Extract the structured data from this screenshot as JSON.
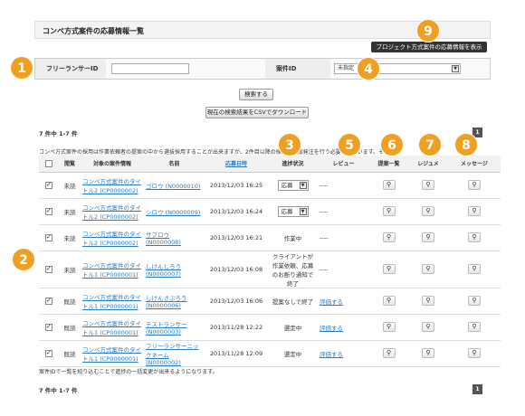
{
  "page": {
    "title": "コンペ方式案件の応募情報一覧",
    "view_project_button": "プロジェクト方式案件の応募情報を表示"
  },
  "search": {
    "freelancer_id_label": "フリーランサーID",
    "freelancer_id_value": "",
    "project_id_label": "案件ID",
    "project_select_value": "未指定",
    "search_button": "検索する",
    "csv_button": "現在の検索結果をCSVでダウンロード"
  },
  "summary": {
    "count_top": "7 件中 1-7 件",
    "count_bottom": "7 件中 1-7 件",
    "page": "1"
  },
  "notice": "コンペ方式案件の採用は作業依頼者の提案の中から選抜採用することが出来ますが、2件目以降の採用は追加発注を行う必要がございます。その場合、追加発注費用が発生いたします。",
  "footer_note": "案件IDで一覧を絞り込むことで進捗の一括変更が出来るようになります。",
  "table": {
    "headers": [
      "",
      "閲覧",
      "対象の案件情報",
      "名前",
      "応募日時",
      "進捗状況",
      "レビュー",
      "提案一覧",
      "レジュメ",
      "メッセージ"
    ],
    "rows": [
      {
        "read": "未読",
        "project": "コンペ方式案件のタイトル2 (CP0000002)",
        "name": "ゴロウ (N0000010)",
        "date": "2013/12/03 16:25",
        "status": "応募",
        "status_type": "select",
        "review": "----",
        "review_type": "text"
      },
      {
        "read": "未読",
        "project": "コンペ方式案件のタイトル2 (CP0000002)",
        "name": "シロウ (N0000009)",
        "date": "2013/12/03 16:24",
        "status": "応募",
        "status_type": "select",
        "review": "----",
        "review_type": "text"
      },
      {
        "read": "未読",
        "project": "コンペ方式案件のタイトル2 (CP0000002)",
        "name": "サブロウ (N0000008)",
        "date": "2013/12/03 16:21",
        "status": "作業中",
        "status_type": "text",
        "review": "----",
        "review_type": "text"
      },
      {
        "read": "未読",
        "project": "コンペ方式案件のタイトル1 (CP0000001)",
        "name": "しけんしろう (N0000007)",
        "date": "2013/12/03 16:08",
        "status": "クライアントが作業依頼、応募のお断り通知で終了",
        "status_type": "text",
        "review": "----",
        "review_type": "text"
      },
      {
        "read": "既読",
        "project": "コンペ方式案件のタイトル1 (CP0000001)",
        "name": "しけんさぶろう (N0000006)",
        "date": "2013/12/03 16:06",
        "status": "提案なしで終了",
        "status_type": "text",
        "review": "評価する",
        "review_type": "link"
      },
      {
        "read": "既読",
        "project": "コンペ方式案件のタイトル1 (CP0000001)",
        "name": "テストランサー (N0000003)",
        "date": "2013/11/28 12:22",
        "status": "選定中",
        "status_type": "text",
        "review": "評価する",
        "review_type": "link"
      },
      {
        "read": "既読",
        "project": "コンペ方式案件のタイトル1 (CP0000001)",
        "name": "フリーランサーニックネーム (N0000002)",
        "date": "2013/11/28 12:09",
        "status": "選定中",
        "status_type": "text",
        "review": "評価する",
        "review_type": "link"
      }
    ]
  },
  "badges": [
    "1",
    "2",
    "3",
    "4",
    "5",
    "6",
    "7",
    "8",
    "9"
  ],
  "icons": {
    "view": "magnifier-icon",
    "dropdown": "chevron-down-icon"
  },
  "colors": {
    "badge": "#f0a020",
    "link": "#2a7cc0",
    "dark_button": "#333333"
  }
}
